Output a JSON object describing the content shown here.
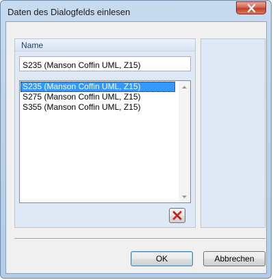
{
  "window": {
    "title": "Daten des Dialogfelds einlesen",
    "close_icon": "close-x-icon"
  },
  "name_panel": {
    "label": "Name",
    "input_value": "S235 (Manson Coffin UML, Z15)",
    "list_items": [
      {
        "label": "S235 (Manson Coffin UML, Z15)",
        "selected": true
      },
      {
        "label": "S275 (Manson Coffin UML, Z15)",
        "selected": false
      },
      {
        "label": "S355 (Manson Coffin UML, Z15)",
        "selected": false
      }
    ],
    "delete_icon": "delete-red-x-icon"
  },
  "buttons": {
    "ok_label": "OK",
    "cancel_label": "Abbrechen"
  },
  "colors": {
    "selection": "#3399ff",
    "close_button": "#c23f2a",
    "delete_icon": "#d42a2a"
  }
}
